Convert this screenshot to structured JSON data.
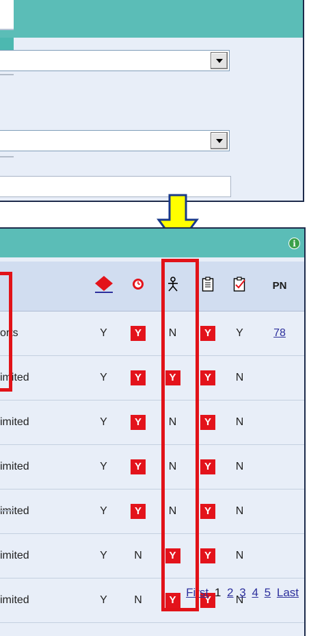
{
  "search_form": {
    "dropdown_1_value": "",
    "dropdown_2_value": "",
    "text_field_value": ""
  },
  "results": {
    "columns": [
      {
        "key": "name",
        "icon": "",
        "label": ""
      },
      {
        "key": "c1",
        "icon": "red-diamond-icon",
        "label": ""
      },
      {
        "key": "c2",
        "icon": "clock-icon",
        "label": ""
      },
      {
        "key": "c3",
        "icon": "person-icon",
        "label": ""
      },
      {
        "key": "c4",
        "icon": "clipboard-icon",
        "label": ""
      },
      {
        "key": "c5",
        "icon": "checklist-icon",
        "label": ""
      },
      {
        "key": "pn",
        "icon": "",
        "label": "PN"
      }
    ],
    "rows": [
      {
        "name": "orts",
        "c1": "Y",
        "c2": "Y",
        "c3": "N",
        "c4": "Y",
        "c5": "Y",
        "pn": "78"
      },
      {
        "name": "imited",
        "c1": "Y",
        "c2": "Y",
        "c3": "Y",
        "c4": "Y",
        "c5": "N",
        "pn": ""
      },
      {
        "name": "imited",
        "c1": "Y",
        "c2": "Y",
        "c3": "N",
        "c4": "Y",
        "c5": "N",
        "pn": ""
      },
      {
        "name": "imited",
        "c1": "Y",
        "c2": "Y",
        "c3": "N",
        "c4": "Y",
        "c5": "N",
        "pn": ""
      },
      {
        "name": "imited",
        "c1": "Y",
        "c2": "Y",
        "c3": "N",
        "c4": "Y",
        "c5": "N",
        "pn": ""
      },
      {
        "name": "imited",
        "c1": "Y",
        "c2": "N",
        "c3": "Y",
        "c4": "Y",
        "c5": "N",
        "pn": ""
      },
      {
        "name": "imited",
        "c1": "Y",
        "c2": "N",
        "c3": "Y",
        "c4": "Y",
        "c5": "N",
        "pn": ""
      }
    ],
    "badge_columns": [
      "c2",
      "c3",
      "c4"
    ],
    "badge_rule": "Y values in c2, c3, c4 are shown as red badges"
  },
  "pager": {
    "first": "First",
    "current": "1",
    "pages": [
      "2",
      "3",
      "4",
      "5"
    ],
    "last": "Last"
  },
  "colors": {
    "header_teal": "#5bbdb7",
    "panel_bg": "#e8eef8",
    "badge_red": "#e3131b",
    "annotation_red": "#e11218",
    "arrow_yellow": "#ffff00"
  }
}
